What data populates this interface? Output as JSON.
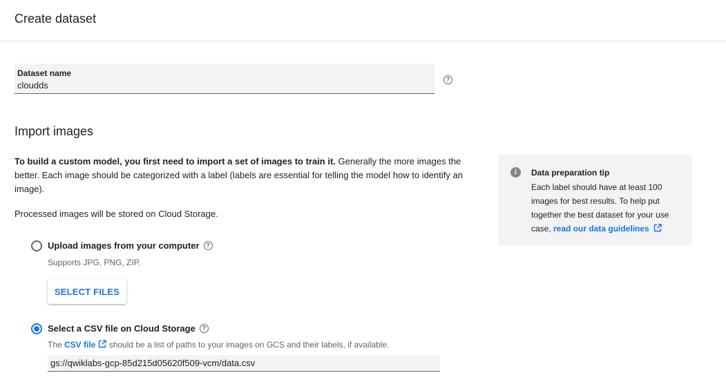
{
  "header": {
    "title": "Create dataset"
  },
  "dataset_name": {
    "label": "Dataset name",
    "value": "cloudds",
    "help_icon": "help-circle-icon"
  },
  "import": {
    "title": "Import images",
    "intro_bold": "To build a custom model, you first need to import a set of images to train it.",
    "intro_rest": " Generally the more images the better. Each image should be categorized with a label (labels are essential for telling the model how to identify an image).",
    "stored_note": "Processed images will be stored on Cloud Storage."
  },
  "upload_option": {
    "label": "Upload images from your computer",
    "hint": "Supports JPG, PNG, ZIP.",
    "button_label": "SELECT FILES",
    "selected": false
  },
  "csv_option": {
    "label": "Select a CSV file on Cloud Storage",
    "hint_prefix": "The ",
    "hint_link": "CSV file",
    "hint_suffix": " should be a list of paths to your images on GCS and their labels, if available.",
    "path_value": "gs://qwiklabs-gcp-85d215d05620f509-vcm/data.csv",
    "selected": true
  },
  "tip": {
    "icon": "info-icon",
    "title": "Data preparation tip",
    "body": "Each label should have at least 100 images for best results. To help put together the best dataset for your use case, ",
    "link": "read our data guidelines"
  },
  "colors": {
    "accent": "#1a73e8",
    "field_bg": "#f1f3f4",
    "text": "#202124",
    "muted": "#5f6368"
  }
}
